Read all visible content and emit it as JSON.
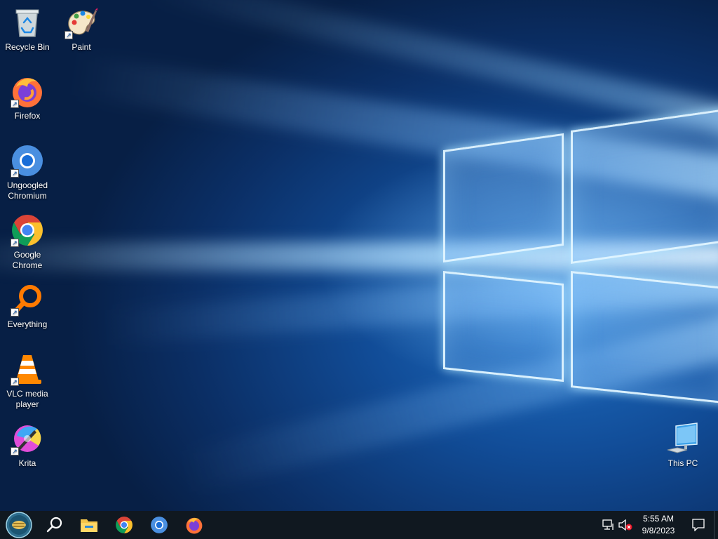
{
  "desktop_icons": {
    "recycle_bin": "Recycle Bin",
    "paint": "Paint",
    "firefox": "Firefox",
    "ungoogled_chromium": "Ungoogled Chromium",
    "google_chrome": "Google Chrome",
    "everything": "Everything",
    "vlc": "VLC media player",
    "krita": "Krita",
    "this_pc": "This PC"
  },
  "taskbar": {
    "pinned": [
      "start",
      "search-icon",
      "file-explorer-icon",
      "google-chrome-icon",
      "chromium-icon",
      "firefox-icon"
    ]
  },
  "tray": {
    "time": "5:55 AM",
    "date": "9/8/2023",
    "icons": [
      "network-icon",
      "volume-muted-icon",
      "notification-icon"
    ]
  },
  "colors": {
    "taskbar": "#101820",
    "wallpaper_blue": "#114c97"
  }
}
